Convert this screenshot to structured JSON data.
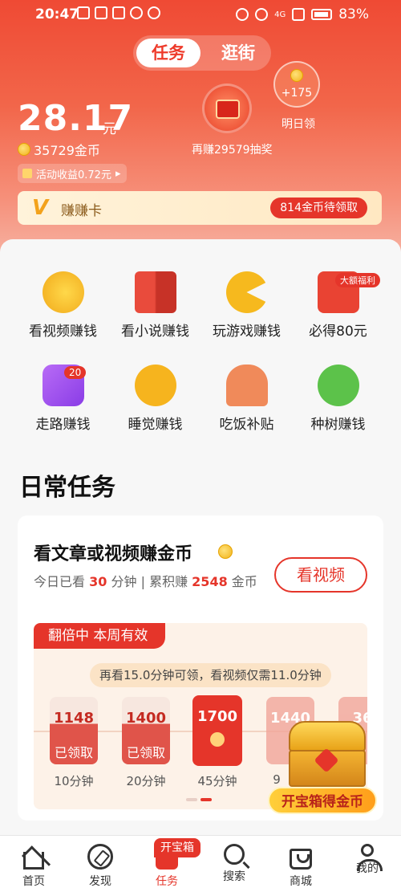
{
  "status_bar": {
    "time": "20:47",
    "signal_tag": "4G",
    "battery": "83%"
  },
  "header": {
    "tabs": [
      {
        "label": "任务",
        "active": true
      },
      {
        "label": "逛街",
        "active": false
      }
    ],
    "balance": "28.17",
    "balance_unit": "元",
    "coins": "35729金币",
    "activity_income": "活动收益0.72元",
    "lottery_label": "再赚29579抽奖",
    "tomorrow_plus": "+175",
    "tomorrow_label": "明日领",
    "earn_card_title": "赚赚卡",
    "earn_card_claim": "814金币待领取",
    "accent": "#e5352a"
  },
  "grid": {
    "row1": [
      {
        "label": "看视频赚钱",
        "icon": "coins-icon"
      },
      {
        "label": "看小说赚钱",
        "icon": "book-icon"
      },
      {
        "label": "玩游戏赚钱",
        "icon": "pacman-icon"
      },
      {
        "label": "必得80元",
        "icon": "red-envelope-icon",
        "badge": "大额福利"
      }
    ],
    "row2": [
      {
        "label": "走路赚钱",
        "icon": "runner-icon",
        "badge": "20"
      },
      {
        "label": "睡觉赚钱",
        "icon": "moon-icon"
      },
      {
        "label": "吃饭补贴",
        "icon": "meal-icon"
      },
      {
        "label": "种树赚钱",
        "icon": "tree-icon"
      }
    ]
  },
  "daily": {
    "title": "日常任务",
    "task_title": "看文章或视频赚金币",
    "today_prefix": "今日已看",
    "today_minutes": "30",
    "today_suffix": "分钟",
    "divider": "|",
    "total_prefix": "累积赚",
    "total_coins": "2548",
    "total_suffix": "金币",
    "watch_button": "看视频",
    "double_tag": "翻倍中 本周有效",
    "tip": "再看15.0分钟可领，看视频仅需11.0分钟",
    "rewards": [
      {
        "amount": "1148",
        "status": "已领取",
        "minutes": "10分钟",
        "state": "done"
      },
      {
        "amount": "1400",
        "status": "已领取",
        "minutes": "20分钟",
        "state": "done"
      },
      {
        "amount": "1700",
        "status": "",
        "minutes": "45分钟",
        "state": "current"
      },
      {
        "amount": "1440",
        "status": "",
        "minutes": "9",
        "state": "future"
      },
      {
        "amount": "36",
        "status": "",
        "minutes": "",
        "state": "future"
      }
    ],
    "chest_button": "开宝箱得金币"
  },
  "bottom_nav": {
    "items": [
      {
        "label": "首页",
        "icon": "home-icon"
      },
      {
        "label": "发现",
        "icon": "compass-icon"
      },
      {
        "label": "任务",
        "icon": "task-icon",
        "active": true
      },
      {
        "label": "搜索",
        "icon": "search-icon"
      },
      {
        "label": "商城",
        "icon": "bag-icon"
      },
      {
        "label": "我的",
        "icon": "user-icon"
      }
    ],
    "task_badge": "开宝箱"
  }
}
